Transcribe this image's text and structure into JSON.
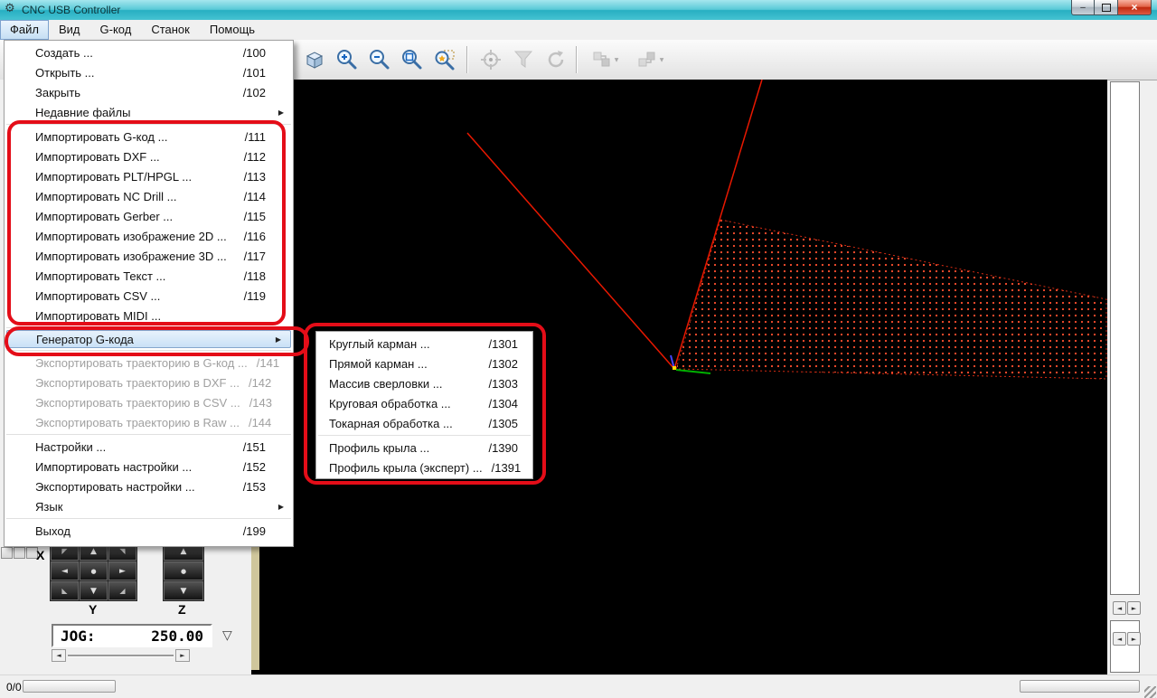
{
  "window": {
    "title": "CNC USB Controller"
  },
  "icons": {
    "app": "⚙",
    "minimize": "–",
    "close": "×",
    "submenu_arrow": "▶",
    "dropdown_arrow": "▼",
    "left_arrow": "◄",
    "right_arrow": "►",
    "up_arrow": "▲",
    "down_arrow": "▼",
    "center_dot": "●",
    "diag_up_left": "◤",
    "diag_up_right": "◥",
    "diag_down_left": "◣",
    "diag_down_right": "◢",
    "jog_dropdown": "▽"
  },
  "menubar": {
    "items": [
      {
        "label": "Файл"
      },
      {
        "label": "Вид"
      },
      {
        "label": "G-код"
      },
      {
        "label": "Станок"
      },
      {
        "label": "Помощь"
      }
    ]
  },
  "file_menu": {
    "items": [
      {
        "label": "Создать ...",
        "shortcut": "/100"
      },
      {
        "label": "Открыть ...",
        "shortcut": "/101"
      },
      {
        "label": "Закрыть",
        "shortcut": "/102"
      },
      {
        "label": "Недавние файлы",
        "shortcut": "",
        "submenu": true
      },
      {
        "label": "Импортировать G-код ...",
        "shortcut": "/111"
      },
      {
        "label": "Импортировать DXF ...",
        "shortcut": "/112"
      },
      {
        "label": "Импортировать PLT/HPGL ...",
        "shortcut": "/113"
      },
      {
        "label": "Импортировать NC Drill ...",
        "shortcut": "/114"
      },
      {
        "label": "Импортировать Gerber ...",
        "shortcut": "/115"
      },
      {
        "label": "Импортировать изображение 2D ...",
        "shortcut": "/116"
      },
      {
        "label": "Импортировать изображение 3D ...",
        "shortcut": "/117"
      },
      {
        "label": "Импортировать Текст ...",
        "shortcut": "/118"
      },
      {
        "label": "Импортировать CSV ...",
        "shortcut": "/119"
      },
      {
        "label": "Импортировать MIDI ...",
        "shortcut": ""
      },
      {
        "label": "Генератор G-кода",
        "shortcut": "",
        "submenu": true,
        "highlighted": true
      },
      {
        "label": "Экспортировать траекторию в G-код ...",
        "shortcut": "/141",
        "disabled": true
      },
      {
        "label": "Экспортировать траекторию в DXF ...",
        "shortcut": "/142",
        "disabled": true
      },
      {
        "label": "Экспортировать траекторию в CSV ...",
        "shortcut": "/143",
        "disabled": true
      },
      {
        "label": "Экспортировать траекторию в Raw ...",
        "shortcut": "/144",
        "disabled": true
      },
      {
        "label": "Настройки ...",
        "shortcut": "/151"
      },
      {
        "label": "Импортировать настройки ...",
        "shortcut": "/152"
      },
      {
        "label": "Экспортировать настройки ...",
        "shortcut": "/153"
      },
      {
        "label": "Язык",
        "shortcut": "",
        "submenu": true
      },
      {
        "label": "Выход",
        "shortcut": "/199"
      }
    ]
  },
  "gcode_submenu": {
    "items": [
      {
        "label": "Круглый карман ...",
        "shortcut": "/1301"
      },
      {
        "label": "Прямой карман ...",
        "shortcut": "/1302"
      },
      {
        "label": "Массив сверловки ...",
        "shortcut": "/1303"
      },
      {
        "label": "Круговая обработка ...",
        "shortcut": "/1304"
      },
      {
        "label": "Токарная обработка ...",
        "shortcut": "/1305"
      },
      {
        "label": "Профиль крыла ...",
        "shortcut": "/1390"
      },
      {
        "label": "Профиль крыла (эксперт) ...",
        "shortcut": "/1391"
      }
    ]
  },
  "toolbar": {
    "buttons": [
      {
        "name": "view-3d-cube",
        "enabled": true
      },
      {
        "name": "zoom-in",
        "enabled": true
      },
      {
        "name": "zoom-out",
        "enabled": true
      },
      {
        "name": "zoom-to-extents",
        "enabled": true
      },
      {
        "name": "zoom-window",
        "enabled": true
      },
      {
        "name": "simulation",
        "enabled": false
      },
      {
        "name": "material-filter",
        "enabled": false
      },
      {
        "name": "rotate-view",
        "enabled": false
      },
      {
        "name": "tool-offset-a",
        "enabled": false
      },
      {
        "name": "tool-offset-b",
        "enabled": false
      }
    ]
  },
  "jog": {
    "label": "JOG:",
    "value": "250.00"
  },
  "axes": {
    "x": "X",
    "y": "Y",
    "z": "Z"
  },
  "statusbar": {
    "counter": "0/0"
  },
  "colors": {
    "titlebar": "#45c2d1",
    "annotation": "#e40d18",
    "viewport_bg": "#000000",
    "toolpath_line": "#e81800",
    "grid_dot": "#ff4f2e",
    "axis_green": "#00b000",
    "axis_blue": "#4444ff",
    "menu_highlight": "#c9e1f6"
  }
}
